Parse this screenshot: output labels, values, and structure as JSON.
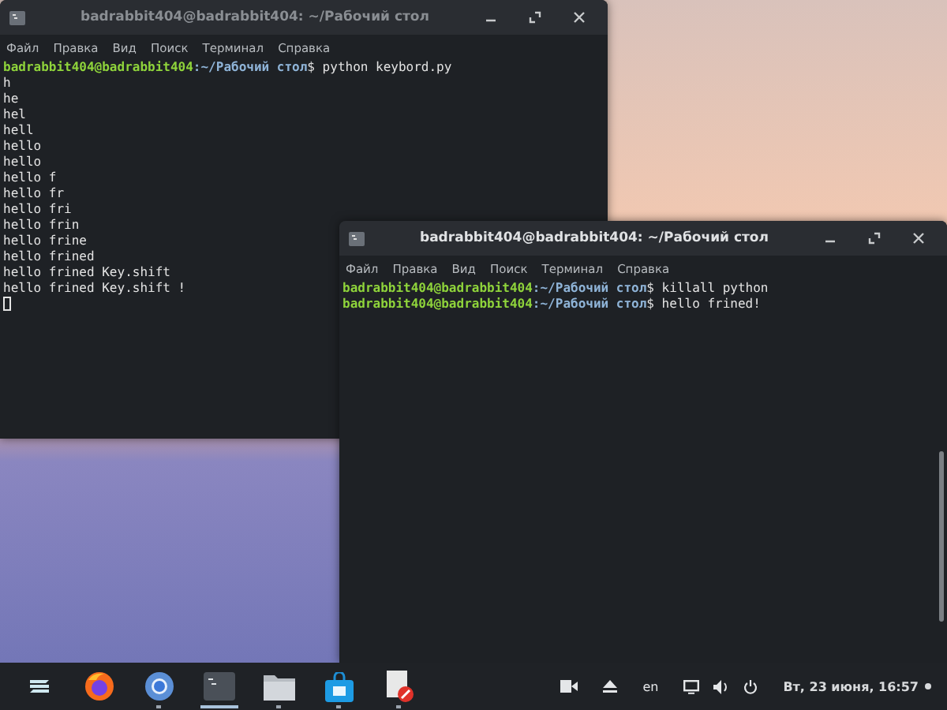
{
  "windows": [
    {
      "title": "badrabbit404@badrabbit404: ~/Рабочий стол",
      "focused": false,
      "menu": [
        "Файл",
        "Правка",
        "Вид",
        "Поиск",
        "Терминал",
        "Справка"
      ],
      "cursor": true,
      "lines": [
        {
          "kind": "prompt",
          "user_host": "badrabbit404@badrabbit404",
          "path": ":~/Рабочий стол",
          "command": "$ python keybord.py"
        },
        {
          "kind": "output",
          "text": "h"
        },
        {
          "kind": "output",
          "text": "he"
        },
        {
          "kind": "output",
          "text": "hel"
        },
        {
          "kind": "output",
          "text": "hell"
        },
        {
          "kind": "output",
          "text": "hello"
        },
        {
          "kind": "output",
          "text": "hello"
        },
        {
          "kind": "output",
          "text": "hello f"
        },
        {
          "kind": "output",
          "text": "hello fr"
        },
        {
          "kind": "output",
          "text": "hello fri"
        },
        {
          "kind": "output",
          "text": "hello frin"
        },
        {
          "kind": "output",
          "text": "hello frine"
        },
        {
          "kind": "output",
          "text": "hello frined"
        },
        {
          "kind": "output",
          "text": "hello frined Key.shift"
        },
        {
          "kind": "output",
          "text": "hello frined Key.shift !"
        }
      ]
    },
    {
      "title": "badrabbit404@badrabbit404: ~/Рабочий стол",
      "focused": true,
      "menu": [
        "Файл",
        "Правка",
        "Вид",
        "Поиск",
        "Терминал",
        "Справка"
      ],
      "scrollbar": true,
      "lines": [
        {
          "kind": "prompt",
          "user_host": "badrabbit404@badrabbit404",
          "path": ":~/Рабочий стол",
          "command": "$ killall python"
        },
        {
          "kind": "prompt",
          "user_host": "badrabbit404@badrabbit404",
          "path": ":~/Рабочий стол",
          "command": "$ hello frined!"
        }
      ]
    }
  ],
  "taskbar": {
    "apps": [
      {
        "kind": "zorin",
        "running": false,
        "selected": false
      },
      {
        "kind": "firefox",
        "running": false,
        "selected": false
      },
      {
        "kind": "chrome",
        "running": true,
        "selected": false
      },
      {
        "kind": "terminal",
        "running": true,
        "selected": true
      },
      {
        "kind": "files",
        "running": true,
        "selected": false
      },
      {
        "kind": "store",
        "running": true,
        "selected": false
      },
      {
        "kind": "document",
        "running": true,
        "selected": false
      }
    ],
    "language": "en",
    "clock": "Вт, 23 июня, 16:57"
  }
}
